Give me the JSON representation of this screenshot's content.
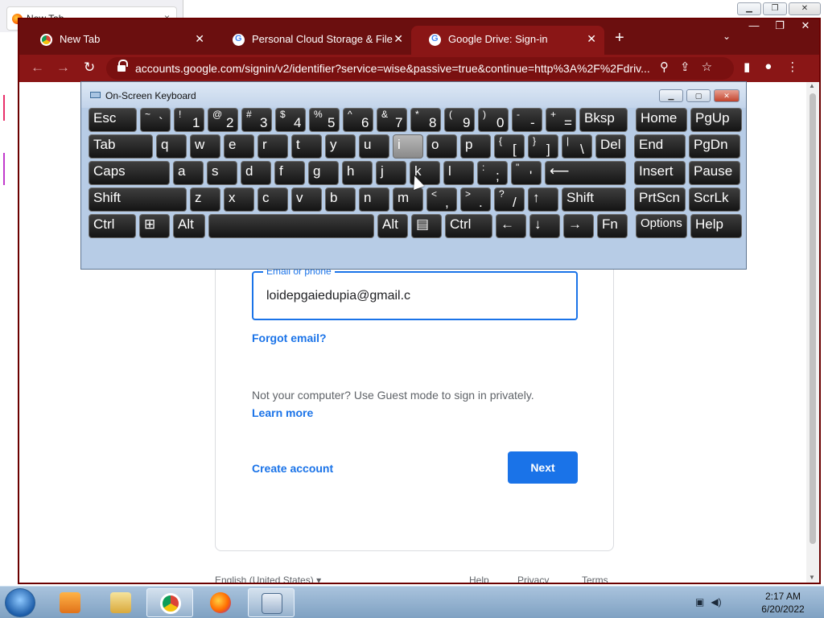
{
  "background_window": {
    "tab_label": "New Tab"
  },
  "browser": {
    "tabs": [
      {
        "label": "New Tab",
        "icon": "chrome-icon"
      },
      {
        "label": "Personal Cloud Storage & File Sh",
        "icon": "google-icon"
      },
      {
        "label": "Google Drive: Sign-in",
        "icon": "google-icon",
        "active": true
      }
    ],
    "url": "accounts.google.com/signin/v2/identifier?service=wise&passive=true&continue=http%3A%2F%2Fdriv...",
    "theme_color": "#8a1616"
  },
  "signin": {
    "email_label": "Email or phone",
    "email_value": "loidepgaiedupia@gmail.c",
    "forgot_email": "Forgot email?",
    "guest_text": "Not your computer? Use Guest mode to sign in privately.",
    "learn_more": "Learn more",
    "create_account": "Create account",
    "next": "Next",
    "accent_color": "#1a73e8"
  },
  "footer": {
    "language": "English (United States)",
    "help": "Help",
    "privacy": "Privacy",
    "terms": "Terms"
  },
  "osk": {
    "title": "On-Screen Keyboard",
    "pressed_key": "i",
    "rows": [
      [
        {
          "label": "Esc"
        },
        {
          "top": "~",
          "bot": "`"
        },
        {
          "top": "!",
          "bot": "1"
        },
        {
          "top": "@",
          "bot": "2"
        },
        {
          "top": "#",
          "bot": "3"
        },
        {
          "top": "$",
          "bot": "4"
        },
        {
          "top": "%",
          "bot": "5"
        },
        {
          "top": "^",
          "bot": "6"
        },
        {
          "top": "&",
          "bot": "7"
        },
        {
          "top": "*",
          "bot": "8"
        },
        {
          "top": "(",
          "bot": "9"
        },
        {
          "top": ")",
          "bot": "0"
        },
        {
          "top": "-",
          "bot": "-"
        },
        {
          "top": "+",
          "bot": "="
        },
        {
          "label": "Bksp"
        },
        {
          "label": "Home"
        },
        {
          "label": "PgUp"
        }
      ],
      [
        {
          "label": "Tab"
        },
        {
          "label": "q"
        },
        {
          "label": "w"
        },
        {
          "label": "e"
        },
        {
          "label": "r"
        },
        {
          "label": "t"
        },
        {
          "label": "y"
        },
        {
          "label": "u"
        },
        {
          "label": "i"
        },
        {
          "label": "o"
        },
        {
          "label": "p"
        },
        {
          "top": "{",
          "bot": "["
        },
        {
          "top": "}",
          "bot": "]"
        },
        {
          "top": "|",
          "bot": "\\"
        },
        {
          "label": "Del"
        },
        {
          "label": "End"
        },
        {
          "label": "PgDn"
        }
      ],
      [
        {
          "label": "Caps"
        },
        {
          "label": "a"
        },
        {
          "label": "s"
        },
        {
          "label": "d"
        },
        {
          "label": "f"
        },
        {
          "label": "g"
        },
        {
          "label": "h"
        },
        {
          "label": "j"
        },
        {
          "label": "k"
        },
        {
          "label": "l"
        },
        {
          "top": ":",
          "bot": ";"
        },
        {
          "top": "\"",
          "bot": "'"
        },
        {
          "label": "⟵"
        },
        {
          "label": "Insert"
        },
        {
          "label": "Pause"
        }
      ],
      [
        {
          "label": "Shift"
        },
        {
          "label": "z"
        },
        {
          "label": "x"
        },
        {
          "label": "c"
        },
        {
          "label": "v"
        },
        {
          "label": "b"
        },
        {
          "label": "n"
        },
        {
          "label": "m"
        },
        {
          "top": "<",
          "bot": ","
        },
        {
          "top": ">",
          "bot": "."
        },
        {
          "top": "?",
          "bot": "/"
        },
        {
          "label": "↑"
        },
        {
          "label": "Shift"
        },
        {
          "label": "PrtScn"
        },
        {
          "label": "ScrLk"
        }
      ],
      [
        {
          "label": "Ctrl"
        },
        {
          "label": "⊞"
        },
        {
          "label": "Alt"
        },
        {
          "label": ""
        },
        {
          "label": "Alt"
        },
        {
          "label": "▤"
        },
        {
          "label": "Ctrl"
        },
        {
          "label": "←"
        },
        {
          "label": "↓"
        },
        {
          "label": "→"
        },
        {
          "label": "Fn"
        },
        {
          "label": "Options"
        },
        {
          "label": "Help"
        }
      ]
    ]
  },
  "taskbar": {
    "items": [
      "media-player-icon",
      "file-explorer-icon",
      "chrome-icon",
      "firefox-icon",
      "on-screen-keyboard-icon"
    ],
    "time": "2:17 AM",
    "date": "6/20/2022"
  }
}
